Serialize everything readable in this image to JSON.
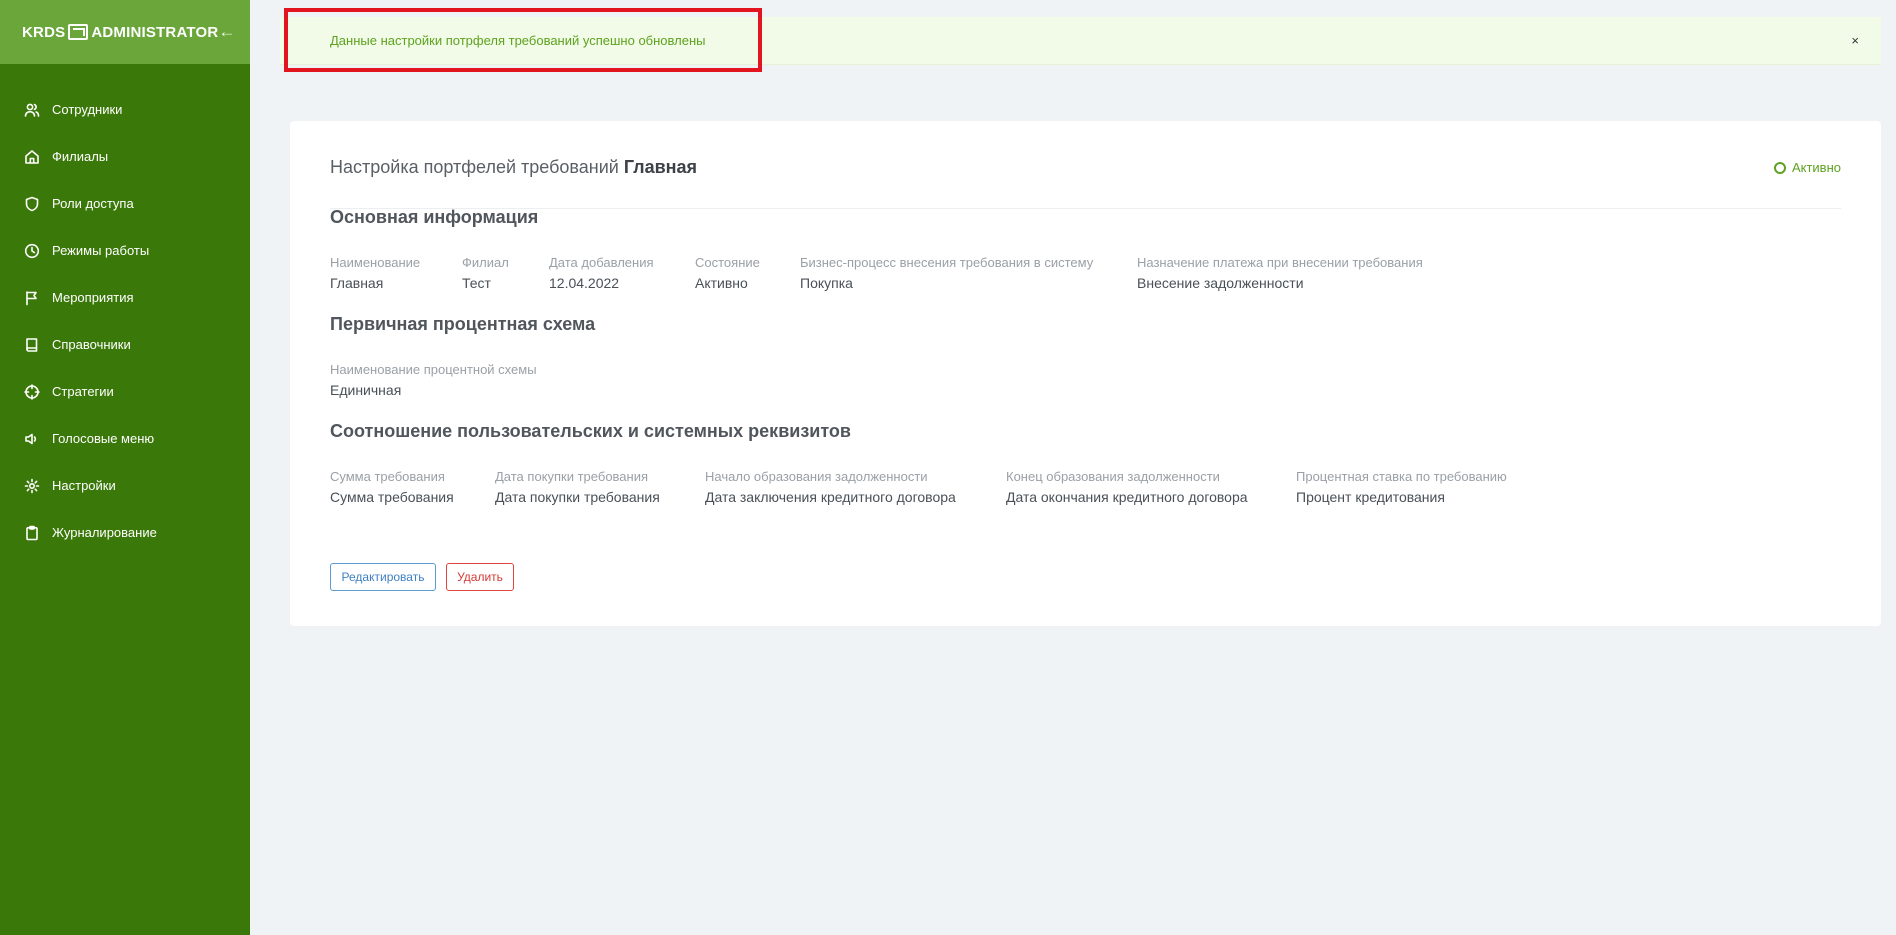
{
  "sidebar": {
    "logo_left": "KRDS",
    "logo_right": "ADMINISTRATOR",
    "items": [
      {
        "label": "Сотрудники"
      },
      {
        "label": "Филиалы"
      },
      {
        "label": "Роли доступа"
      },
      {
        "label": "Режимы работы"
      },
      {
        "label": "Мероприятия"
      },
      {
        "label": "Справочники"
      },
      {
        "label": "Стратегии"
      },
      {
        "label": "Голосовые меню"
      },
      {
        "label": "Настройки"
      },
      {
        "label": "Журналирование"
      }
    ]
  },
  "alert": {
    "message": "Данные настройки потрфеля требований успешно обновлены",
    "close": "×"
  },
  "card": {
    "title_prefix": "Настройка портфелей требований",
    "title_name": "Главная",
    "status": "Активно",
    "sections": {
      "main": {
        "title": "Основная информация",
        "fields": [
          {
            "label": "Наименование",
            "value": "Главная"
          },
          {
            "label": "Филиал",
            "value": "Тест"
          },
          {
            "label": "Дата добавления",
            "value": "12.04.2022"
          },
          {
            "label": "Состояние",
            "value": "Активно"
          },
          {
            "label": "Бизнес-процесс внесения требования в систему",
            "value": "Покупка"
          },
          {
            "label": "Назначение платежа при внесении требования",
            "value": "Внесение задолженности"
          }
        ]
      },
      "interest": {
        "title": "Первичная процентная схема",
        "fields": [
          {
            "label": "Наименование процентной схемы",
            "value": "Единичная"
          }
        ]
      },
      "mapping": {
        "title": "Соотношение пользовательских и системных реквизитов",
        "fields": [
          {
            "label": "Сумма требования",
            "value": "Сумма требования"
          },
          {
            "label": "Дата покупки требования",
            "value": "Дата покупки требования"
          },
          {
            "label": "Начало образования задолженности",
            "value": "Дата заключения кредитного договора"
          },
          {
            "label": "Конец образования задолженности",
            "value": "Дата окончания кредитного договора"
          },
          {
            "label": "Процентная ставка по требованию",
            "value": "Процент кредитования"
          }
        ]
      }
    },
    "buttons": {
      "edit": "Редактировать",
      "delete": "Удалить"
    }
  },
  "colors": {
    "sidebar": "#3b780a",
    "sidebar_header": "#6aa63a",
    "success": "#5ea21f",
    "highlight": "#e1141f"
  }
}
